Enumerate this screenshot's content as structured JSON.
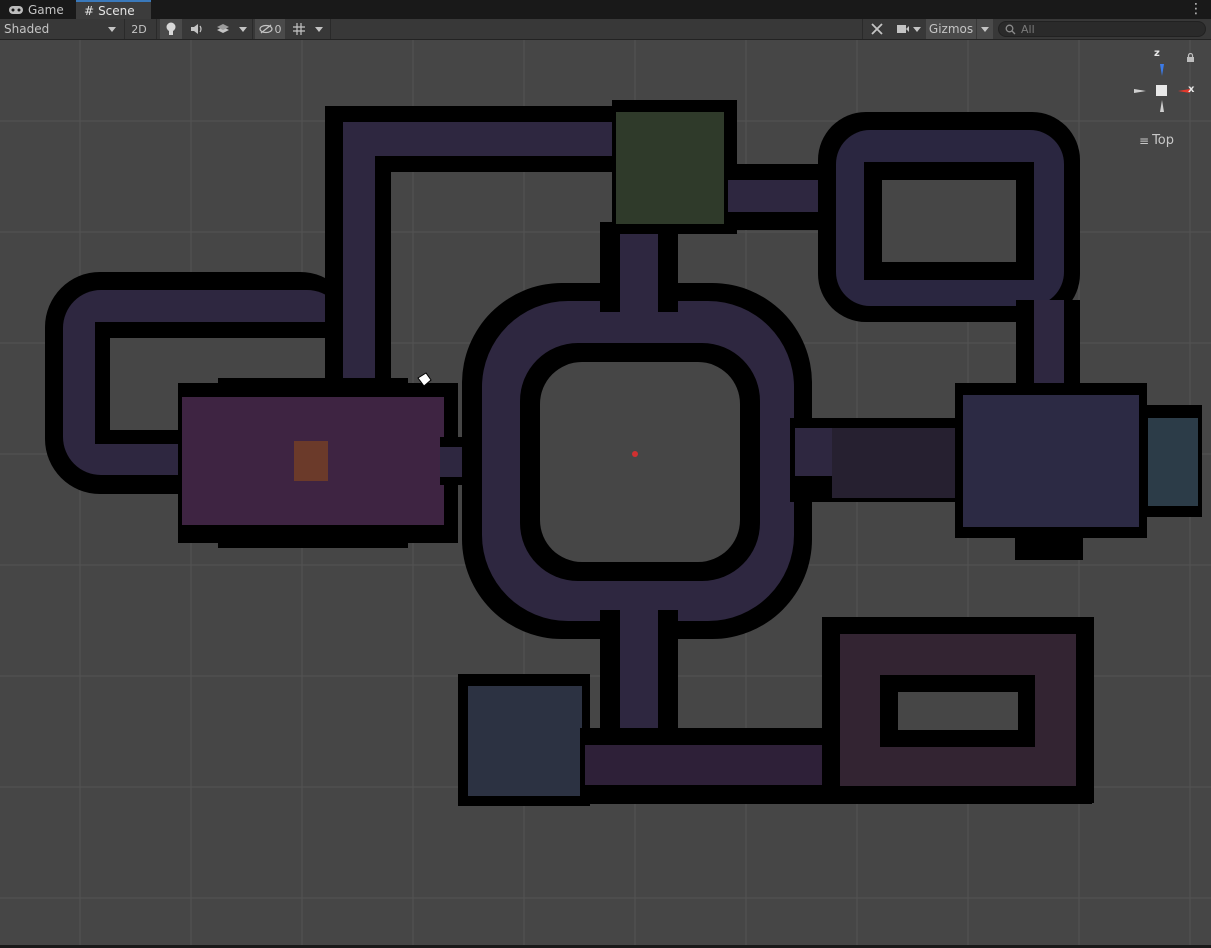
{
  "tabs": [
    {
      "label": "Game",
      "icon": "gamepad-icon",
      "active": false
    },
    {
      "label": "Scene",
      "icon": "hash-icon",
      "active": true
    }
  ],
  "toolbar": {
    "shading_mode": "Shaded",
    "mode_2d_label": "2D",
    "hidden_count": "0",
    "gizmos_label": "Gizmos",
    "search_placeholder": "All"
  },
  "gizmo": {
    "axis_z": "z",
    "axis_x": "x",
    "view_label": "Top"
  },
  "colors": {
    "background": "#464646",
    "tabbar": "#191919",
    "toolbar": "#383838",
    "accent": "#3a79bb",
    "axis_x": "#e5392c",
    "axis_z": "#3b7be9",
    "wall": "#000000"
  }
}
